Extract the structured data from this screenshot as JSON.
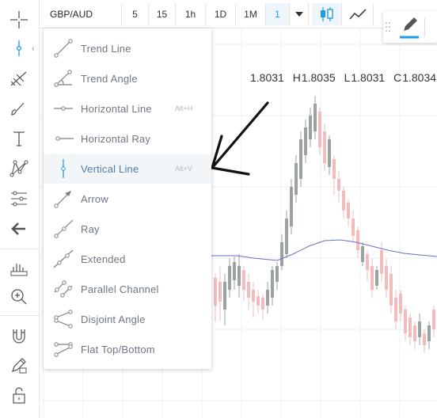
{
  "toolbar": {
    "symbol": "GBP/AUD",
    "intervals": [
      "5",
      "15",
      "1h",
      "1D",
      "1M",
      "1"
    ],
    "active_interval": "1",
    "dropdown_icon": "caret-down-icon",
    "chart_type_icons": [
      "candles-icon",
      "line-chart-icon"
    ]
  },
  "ohlc": {
    "open": "1.8031",
    "high_label": "H",
    "high": "1.8035",
    "low_label": "L",
    "low": "1.8031",
    "close_label": "C",
    "close": "1.8034"
  },
  "drawing_menu": {
    "items": [
      {
        "label": "Trend Line",
        "shortcut": "",
        "icon": "trend-line-icon",
        "selected": false
      },
      {
        "label": "Trend Angle",
        "shortcut": "",
        "icon": "trend-angle-icon",
        "selected": false
      },
      {
        "label": "Horizontal Line",
        "shortcut": "Alt+H",
        "icon": "horizontal-line-icon",
        "selected": false
      },
      {
        "label": "Horizontal Ray",
        "shortcut": "",
        "icon": "horizontal-ray-icon",
        "selected": false
      },
      {
        "label": "Vertical Line",
        "shortcut": "Alt+V",
        "icon": "vertical-line-icon",
        "selected": true
      },
      {
        "label": "Arrow",
        "shortcut": "",
        "icon": "arrow-icon",
        "selected": false
      },
      {
        "label": "Ray",
        "shortcut": "",
        "icon": "ray-icon",
        "selected": false
      },
      {
        "label": "Extended",
        "shortcut": "",
        "icon": "extended-line-icon",
        "selected": false
      },
      {
        "label": "Parallel Channel",
        "shortcut": "",
        "icon": "parallel-channel-icon",
        "selected": false
      },
      {
        "label": "Disjoint Angle",
        "shortcut": "",
        "icon": "disjoint-angle-icon",
        "selected": false
      },
      {
        "label": "Flat Top/Bottom",
        "shortcut": "",
        "icon": "flat-top-bottom-icon",
        "selected": false
      }
    ]
  },
  "left_toolbar": {
    "tools": [
      "crosshair-icon",
      "vertical-line-tool-icon",
      "pitchfork-icon",
      "brush-icon",
      "text-icon",
      "pattern-icon",
      "fib-icon",
      "back-arrow-icon",
      "measure-icon",
      "zoom-icon",
      "magnet-icon",
      "lock-drawing-icon",
      "unlock-icon"
    ]
  },
  "right_panel": {
    "icons": [
      "drag-handle-icon",
      "pencil-icon"
    ]
  },
  "colors": {
    "accent": "#1e9be6",
    "bull_candle": "#9aa2a2",
    "bear_candle": "#f2bcbc",
    "ma_line": "#6b6fc4",
    "grid": "#eceff2"
  }
}
